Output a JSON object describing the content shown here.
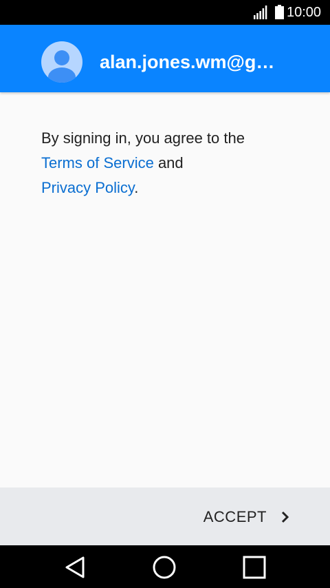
{
  "status_bar": {
    "time": "10:00",
    "icons": [
      "signal-icon",
      "battery-icon"
    ]
  },
  "header": {
    "account_email": "alan.jones.wm@g…",
    "avatar_icon": "account-avatar-icon"
  },
  "terms": {
    "intro": "By signing in, you agree to the",
    "terms_link": "Terms of Service",
    "conjunction": " and",
    "privacy_link": "Privacy Policy",
    "end_punctuation": "."
  },
  "actions": {
    "accept_label": "ACCEPT",
    "accept_icon": "chevron-right-icon"
  },
  "navigation": {
    "icons": [
      "back-icon",
      "home-icon",
      "recents-icon"
    ]
  },
  "colors": {
    "header": "#0a84ff",
    "link": "#0a6ed1",
    "action_bar": "#e8eaed",
    "background": "#fafafa"
  }
}
